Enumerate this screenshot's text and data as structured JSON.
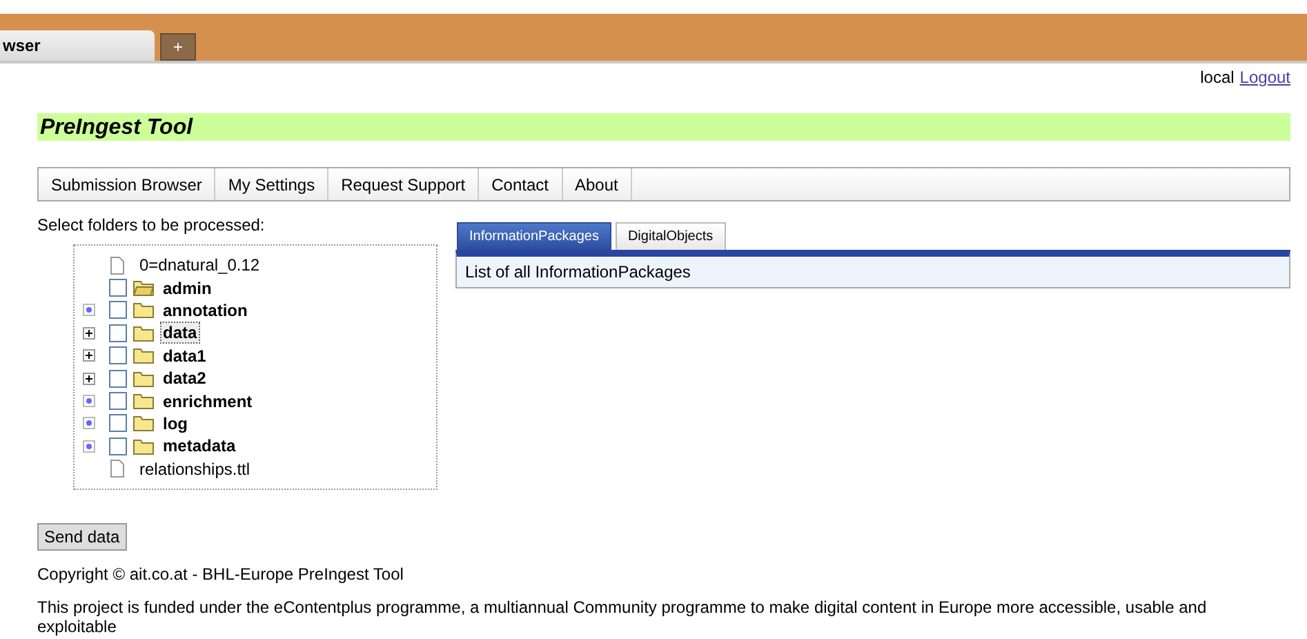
{
  "browser": {
    "tab": "wser",
    "new_tab": "+"
  },
  "user": {
    "name": "local",
    "logout": "Logout"
  },
  "title": "PreIngest Tool",
  "menu": [
    "Submission Browser",
    "My Settings",
    "Request Support",
    "Contact",
    "About"
  ],
  "select_label": "Select folders to be processed:",
  "tree": [
    {
      "kind": "file",
      "name": "0=dnatural_0.12",
      "expandable": false,
      "selected": false
    },
    {
      "kind": "folder",
      "name": "admin",
      "expandable": false,
      "checked": false,
      "open": true,
      "selected": false
    },
    {
      "kind": "folder",
      "name": "annotation",
      "expandable": true,
      "has_children": false,
      "checked": false,
      "open": false,
      "selected": false
    },
    {
      "kind": "folder",
      "name": "data",
      "expandable": true,
      "has_children": true,
      "checked": false,
      "open": false,
      "selected": true
    },
    {
      "kind": "folder",
      "name": "data1",
      "expandable": true,
      "has_children": true,
      "checked": false,
      "open": false,
      "selected": false
    },
    {
      "kind": "folder",
      "name": "data2",
      "expandable": true,
      "has_children": true,
      "checked": false,
      "open": false,
      "selected": false
    },
    {
      "kind": "folder",
      "name": "enrichment",
      "expandable": true,
      "has_children": false,
      "checked": false,
      "open": false,
      "selected": false
    },
    {
      "kind": "folder",
      "name": "log",
      "expandable": true,
      "has_children": false,
      "checked": false,
      "open": false,
      "selected": false
    },
    {
      "kind": "folder",
      "name": "metadata",
      "expandable": true,
      "has_children": false,
      "checked": false,
      "open": false,
      "selected": false
    },
    {
      "kind": "file",
      "name": "relationships.ttl",
      "expandable": false,
      "selected": false
    }
  ],
  "tabs": [
    {
      "label": "InformationPackages",
      "selected": true
    },
    {
      "label": "DigitalObjects",
      "selected": false
    }
  ],
  "panel_text": "List of all InformationPackages",
  "send_button": "Send data",
  "copyright": "Copyright © ait.co.at - BHL-Europe PreIngest Tool",
  "funding": "This project is funded under the eContentplus programme, a multiannual Community programme to make digital content in Europe more accessible, usable and exploitable"
}
